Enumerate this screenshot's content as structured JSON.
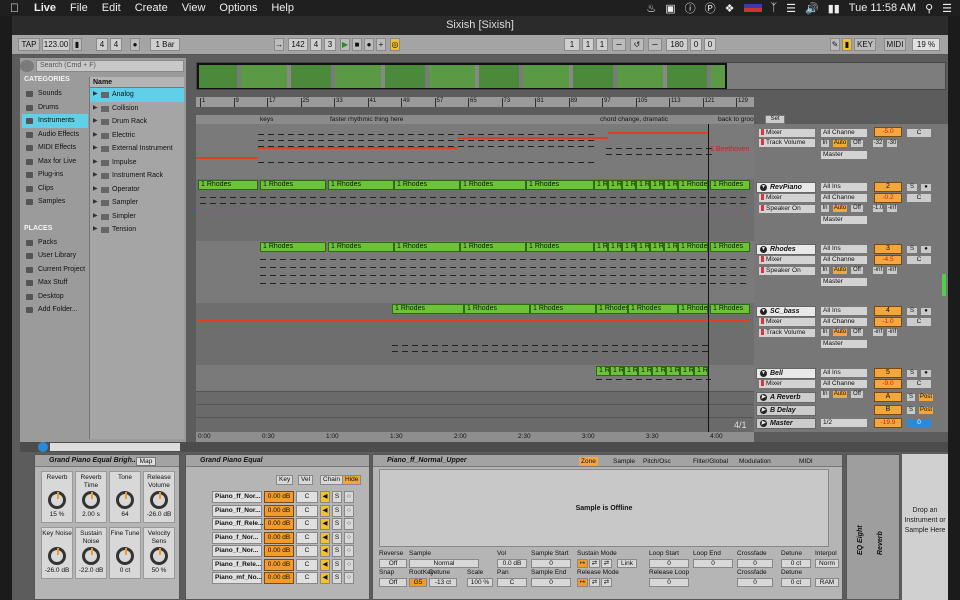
{
  "menubar": {
    "app": "Live",
    "items": [
      "File",
      "Edit",
      "Create",
      "View",
      "Options",
      "Help"
    ],
    "clock": "Tue 11:58 AM",
    "battery_icon": "battery-icon",
    "wifi_icon": "wifi-icon"
  },
  "window": {
    "title": "Sixish  [Sixish]"
  },
  "control": {
    "tap": "TAP",
    "tempo": "123.00",
    "sig_num": "4",
    "sig_den": "4",
    "quant": "1 Bar",
    "arr_pos": [
      "142",
      "4",
      "3"
    ],
    "loop_start": [
      "1",
      "1",
      "1"
    ],
    "loop_len": [
      "180",
      "0",
      "0"
    ],
    "key": "KEY",
    "midi": "MIDI",
    "cpu": "19 %",
    "d_label": "D"
  },
  "browser": {
    "search_placeholder": "Search (Cmd + F)",
    "categories_header": "CATEGORIES",
    "name_header": "Name",
    "categories": [
      "Sounds",
      "Drums",
      "Instruments",
      "Audio Effects",
      "MIDI Effects",
      "Max for Live",
      "Plug-ins",
      "Clips",
      "Samples"
    ],
    "places_header": "PLACES",
    "places": [
      "Packs",
      "User Library",
      "Current Project",
      "Max Stuff",
      "Desktop",
      "Add Folder..."
    ],
    "files": [
      "Analog",
      "Collision",
      "Drum Rack",
      "Electric",
      "External Instrument",
      "Impulse",
      "Instrument Rack",
      "Operator",
      "Sampler",
      "Simpler",
      "Tension"
    ]
  },
  "ruler": {
    "ticks": [
      "1",
      "9",
      "17",
      "25",
      "33",
      "41",
      "49",
      "57",
      "65",
      "73",
      "81",
      "89",
      "97",
      "105",
      "113",
      "121",
      "129"
    ],
    "set": "Set"
  },
  "locators": [
    "keys",
    "faster rhythmic thing here",
    "chord change, dramatic",
    "back to groo"
  ],
  "times": [
    "0:00",
    "0:30",
    "1:00",
    "1:30",
    "2:00",
    "2:30",
    "3:00",
    "3:30",
    "4:00"
  ],
  "zoom": "4/1",
  "tracks": [
    {
      "name": "",
      "in": "Mixer",
      "auto": "Track Volume",
      "chan": "All Channe",
      "num": "1",
      "vol": "-5.0",
      "pan": "C",
      "v1": "-32",
      "v2": "-30",
      "master": "Master",
      "clip": "1 Beethoven"
    },
    {
      "name": "RevPiano",
      "in": "All Ins",
      "auto": "Mixer",
      "param": "Speaker On",
      "chan": "All Channe",
      "num": "2",
      "vol": "-0.2",
      "pan": "C",
      "v1": "-1.0",
      "v2": "-inf",
      "master": "Master",
      "clip": "1 Rhodes"
    },
    {
      "name": "Rhodes",
      "in": "All Ins",
      "auto": "Mixer",
      "param": "Speaker On",
      "chan": "All Channe",
      "num": "3",
      "vol": "-4.5",
      "pan": "C",
      "v1": "-inf",
      "v2": "-inf",
      "master": "Master",
      "clip": "1 Rhodes"
    },
    {
      "name": "SC_bass",
      "in": "All Ins",
      "auto": "Mixer",
      "param": "Track Volume",
      "chan": "All Channe",
      "num": "4",
      "vol": "-1.0",
      "pan": "C",
      "v1": "-inf",
      "v2": "-inf",
      "master": "Master",
      "clip": "1 Rhodes"
    },
    {
      "name": "Bell",
      "in": "All Ins",
      "auto": "Mixer",
      "chan": "All Channe",
      "num": "5",
      "vol": "-9.0",
      "pan": "C",
      "clip": "1 Rh"
    }
  ],
  "returns": [
    {
      "name": "A Reverb",
      "letter": "A",
      "post": "Post"
    },
    {
      "name": "B Delay",
      "letter": "B",
      "post": "Post"
    }
  ],
  "master": {
    "name": "Master",
    "route": "1/2",
    "vol": "-19.9",
    "num": "0",
    "in": "In",
    "auto": "Auto",
    "off": "Off",
    "s": "S"
  },
  "device1": {
    "title": "Grand Piano Equal Brigh...",
    "map": "Map",
    "knobs": [
      {
        "l": "Reverb",
        "v": "15 %"
      },
      {
        "l": "Reverb Time",
        "v": "2.00 s"
      },
      {
        "l": "Tone",
        "v": "64"
      },
      {
        "l": "Release Volume",
        "v": "-26.0 dB"
      },
      {
        "l": "Key Noise",
        "v": "-26.0 dB"
      },
      {
        "l": "Sustain Noise",
        "v": "-22.0 dB"
      },
      {
        "l": "Fine Tune",
        "v": "0 ct"
      },
      {
        "l": "Velocity Sens",
        "v": "50 %"
      }
    ]
  },
  "device2": {
    "title": "Grand Piano Equal",
    "tabs": [
      "Key",
      "Vel",
      "Chain",
      "Hide"
    ],
    "zones": [
      {
        "n": "Piano_ff_Nor...",
        "d": "0.00 dB"
      },
      {
        "n": "Piano_ff_Nor...",
        "d": "0.00 dB"
      },
      {
        "n": "Piano_ff_Rele...",
        "d": "0.00 dB"
      },
      {
        "n": "Piano_f_Nor...",
        "d": "0.00 dB"
      },
      {
        "n": "Piano_f_Nor...",
        "d": "0.00 dB"
      },
      {
        "n": "Piano_f_Rele...",
        "d": "0.00 dB"
      },
      {
        "n": "Piano_mf_No...",
        "d": "0.00 dB"
      }
    ],
    "pan": "C"
  },
  "device3": {
    "title": "Piano_ff_Normal_Upper",
    "tabs": [
      "Zone",
      "Sample",
      "Pitch/Osc",
      "Filter/Global",
      "Modulation",
      "MIDI"
    ],
    "offline": "Sample is Offline",
    "labels": {
      "reverse": "Reverse",
      "sample": "Sample",
      "vol": "Vol",
      "sstart": "Sample Start",
      "smode": "Sustain Mode",
      "lstart": "Loop Start",
      "lend": "Loop End",
      "xfade": "Crossfade",
      "detune": "Detune",
      "interp": "Interpol",
      "snap": "Snap",
      "rootkey": "RootKey",
      "detune2": "Detune",
      "scale": "Scale",
      "pan": "Pan",
      "send": "Sample End",
      "rmode": "Release Mode",
      "rloop": "Release Loop",
      "xfade2": "Crossfade",
      "detune3": "Detune"
    },
    "vals": {
      "reverse": "Off",
      "sample": "Normal",
      "vol": "0.0 dB",
      "sstart": "0",
      "lstart": "0",
      "lend": "0",
      "xfade": "0",
      "detune": "0 ct",
      "interp": "Norm",
      "snap": "Off",
      "rootkey": "G5",
      "detune2": "-13 ct",
      "scale": "100 %",
      "pan": "C",
      "send": "0",
      "rloop": "0",
      "xfade2": "0",
      "detune3": "0 ct",
      "ram": "RAM",
      "link": "Link"
    }
  },
  "device4": {
    "eq": "EQ Eight",
    "reverb": "Reverb"
  },
  "dropzone": "Drop an Instrument or Sample Here"
}
